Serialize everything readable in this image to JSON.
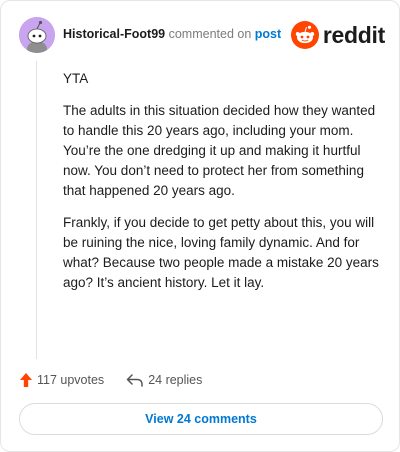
{
  "header": {
    "username": "Historical-Foot99",
    "action": "commented on",
    "link": "post",
    "logo_text": "reddit"
  },
  "comment": {
    "paragraphs": [
      "YTA",
      "The adults in this situation decided how they wanted to handle this 20 years ago, including your mom. You’re the one dredging it up and making it hurtful now. You don’t need to protect her from something that happened 20 years ago.",
      "Frankly, if you decide to get petty about this, you will be ruining the nice, loving family dynamic. And for what? Because two people made a mistake 20 years ago? It’s ancient history. Let it lay."
    ]
  },
  "stats": {
    "upvotes": "117 upvotes",
    "replies": "24 replies"
  },
  "footer": {
    "view_comments": "View 24 comments"
  },
  "colors": {
    "accent": "#0079d3",
    "upvote": "#ff4500",
    "avatar_bg": "#c9a5f0"
  },
  "icons": {
    "upvote": "upvote-arrow-icon",
    "reply": "reply-arrow-icon",
    "logo": "reddit-snoo-icon"
  }
}
